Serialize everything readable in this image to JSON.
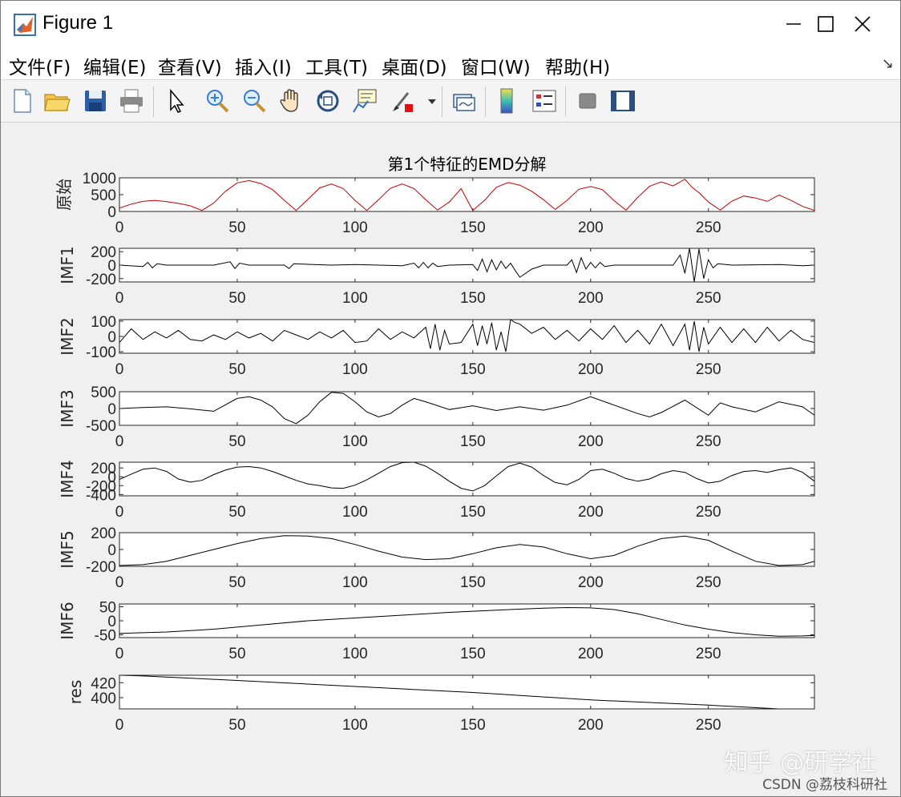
{
  "window": {
    "title": "Figure 1"
  },
  "menubar": {
    "items": [
      "文件(F)",
      "编辑(E)",
      "查看(V)",
      "插入(I)",
      "工具(T)",
      "桌面(D)",
      "窗口(W)",
      "帮助(H)"
    ]
  },
  "toolbar": {
    "icons": [
      "new-figure-icon",
      "open-file-icon",
      "save-icon",
      "print-icon",
      "select-arrow-icon",
      "zoom-in-icon",
      "zoom-out-icon",
      "pan-hand-icon",
      "rotate-3d-icon",
      "data-cursor-icon",
      "brush-icon",
      "link-plot-icon",
      "colorbar-icon",
      "legend-icon",
      "hide-plot-tools-icon",
      "show-plot-tools-icon"
    ]
  },
  "colors": {
    "original_line": "#c00000",
    "imf_line": "#000000",
    "axes_bg": "#ffffff",
    "figure_bg": "#f0f0f0"
  },
  "watermark": {
    "zhihu": "知乎 @研学社",
    "csdn": "CSDN @荔枝科研社"
  },
  "chart_data": {
    "type": "line",
    "title": "第1个特征的EMD分解",
    "xlim": [
      0,
      295
    ],
    "xticks": [
      0,
      50,
      100,
      150,
      200,
      250
    ],
    "subplots": [
      {
        "ylabel": "原始",
        "ylim": [
          0,
          1000
        ],
        "yticks": [
          0,
          500,
          1000
        ],
        "color": "#c00000",
        "x": [
          0,
          5,
          10,
          15,
          20,
          25,
          30,
          35,
          40,
          45,
          50,
          55,
          60,
          65,
          70,
          75,
          80,
          85,
          90,
          95,
          100,
          105,
          110,
          115,
          120,
          125,
          130,
          135,
          140,
          145,
          150,
          155,
          160,
          165,
          170,
          175,
          180,
          185,
          190,
          195,
          200,
          205,
          210,
          215,
          220,
          225,
          230,
          235,
          240,
          243,
          246,
          250,
          255,
          260,
          265,
          270,
          275,
          280,
          285,
          290,
          295
        ],
        "y": [
          100,
          220,
          300,
          330,
          290,
          240,
          170,
          30,
          250,
          600,
          850,
          920,
          830,
          650,
          330,
          30,
          360,
          700,
          820,
          680,
          330,
          30,
          350,
          690,
          820,
          680,
          350,
          40,
          280,
          680,
          30,
          330,
          720,
          860,
          780,
          600,
          350,
          60,
          330,
          660,
          740,
          650,
          320,
          40,
          420,
          750,
          880,
          760,
          960,
          720,
          560,
          280,
          40,
          310,
          460,
          400,
          300,
          490,
          330,
          150,
          30
        ]
      },
      {
        "ylabel": "IMF1",
        "ylim": [
          -250,
          250
        ],
        "yticks": [
          -200,
          0,
          200
        ],
        "color": "#000000",
        "x": [
          0,
          10,
          12,
          14,
          16,
          20,
          40,
          47,
          49,
          51,
          55,
          70,
          72,
          74,
          90,
          100,
          120,
          125,
          127,
          129,
          131,
          133,
          135,
          140,
          150,
          152,
          154,
          156,
          158,
          160,
          162,
          164,
          166,
          168,
          170,
          175,
          180,
          190,
          192,
          194,
          196,
          198,
          200,
          202,
          204,
          206,
          210,
          220,
          235,
          238,
          240,
          242,
          244,
          246,
          248,
          250,
          252,
          254,
          260,
          280,
          290,
          295
        ],
        "y": [
          0,
          -20,
          40,
          -40,
          20,
          0,
          0,
          50,
          -50,
          30,
          0,
          0,
          -50,
          20,
          0,
          10,
          -10,
          30,
          -40,
          40,
          -40,
          30,
          -20,
          0,
          10,
          -80,
          90,
          -100,
          80,
          -70,
          60,
          -50,
          30,
          -80,
          -180,
          -60,
          0,
          0,
          80,
          -110,
          110,
          -60,
          40,
          -40,
          40,
          -20,
          0,
          0,
          0,
          150,
          -120,
          250,
          -250,
          240,
          -200,
          80,
          -40,
          20,
          0,
          10,
          -10,
          0
        ]
      },
      {
        "ylabel": "IMF2",
        "ylim": [
          -110,
          110
        ],
        "yticks": [
          -100,
          0,
          100
        ],
        "color": "#000000",
        "x": [
          0,
          5,
          10,
          15,
          20,
          25,
          30,
          35,
          40,
          45,
          50,
          55,
          60,
          65,
          70,
          75,
          80,
          85,
          90,
          95,
          100,
          105,
          110,
          115,
          120,
          125,
          130,
          132,
          134,
          136,
          138,
          140,
          145,
          150,
          152,
          154,
          156,
          158,
          160,
          162,
          164,
          166,
          168,
          170,
          175,
          180,
          185,
          190,
          195,
          200,
          205,
          210,
          215,
          220,
          225,
          230,
          235,
          240,
          242,
          244,
          246,
          248,
          250,
          255,
          260,
          265,
          270,
          275,
          280,
          285,
          290,
          295
        ],
        "y": [
          -40,
          50,
          -20,
          30,
          -10,
          40,
          -20,
          -30,
          10,
          -20,
          30,
          -10,
          20,
          -30,
          40,
          10,
          -20,
          30,
          -10,
          40,
          -40,
          -30,
          50,
          -20,
          30,
          -10,
          60,
          -80,
          80,
          -90,
          40,
          -50,
          -40,
          80,
          -60,
          70,
          -50,
          90,
          -90,
          30,
          -100,
          110,
          90,
          80,
          20,
          60,
          -20,
          40,
          -30,
          50,
          -20,
          70,
          -40,
          40,
          -50,
          80,
          -60,
          80,
          -90,
          100,
          -100,
          60,
          -50,
          60,
          -40,
          50,
          -40,
          60,
          -30,
          40,
          -20,
          -40
        ]
      },
      {
        "ylabel": "IMF3",
        "ylim": [
          -500,
          500
        ],
        "yticks": [
          -500,
          0,
          500
        ],
        "color": "#000000",
        "x": [
          0,
          10,
          20,
          30,
          40,
          50,
          55,
          60,
          65,
          70,
          75,
          80,
          85,
          90,
          95,
          100,
          105,
          110,
          115,
          120,
          125,
          130,
          140,
          150,
          160,
          170,
          180,
          190,
          200,
          210,
          220,
          225,
          230,
          240,
          250,
          255,
          260,
          270,
          280,
          290,
          295
        ],
        "y": [
          0,
          30,
          50,
          -10,
          -80,
          300,
          350,
          250,
          50,
          -300,
          -450,
          -200,
          200,
          480,
          450,
          200,
          -100,
          -250,
          -150,
          100,
          300,
          200,
          -30,
          80,
          -60,
          50,
          -50,
          100,
          350,
          100,
          -150,
          -250,
          -120,
          250,
          -200,
          170,
          50,
          -100,
          200,
          50,
          -200
        ]
      },
      {
        "ylabel": "IMF4",
        "ylim": [
          -430,
          330
        ],
        "yticks": [
          -400,
          -200,
          0,
          200
        ],
        "color": "#000000",
        "x": [
          0,
          5,
          10,
          15,
          20,
          25,
          30,
          35,
          40,
          45,
          50,
          55,
          60,
          65,
          70,
          75,
          80,
          85,
          90,
          95,
          100,
          105,
          110,
          115,
          120,
          125,
          130,
          135,
          140,
          145,
          150,
          155,
          160,
          165,
          170,
          175,
          180,
          185,
          190,
          195,
          200,
          205,
          210,
          215,
          220,
          225,
          230,
          235,
          240,
          245,
          250,
          255,
          260,
          265,
          270,
          275,
          280,
          285,
          290,
          295
        ],
        "y": [
          -60,
          60,
          170,
          200,
          120,
          -50,
          -120,
          -80,
          50,
          150,
          220,
          230,
          200,
          120,
          20,
          -80,
          -160,
          -200,
          -250,
          -260,
          -190,
          -70,
          80,
          230,
          320,
          330,
          240,
          80,
          -100,
          -260,
          -320,
          -200,
          20,
          230,
          310,
          220,
          30,
          -130,
          -180,
          -60,
          140,
          170,
          80,
          -40,
          -100,
          -50,
          70,
          140,
          100,
          -40,
          -140,
          -100,
          30,
          120,
          140,
          100,
          160,
          200,
          100,
          -100
        ]
      },
      {
        "ylabel": "IMF5",
        "ylim": [
          -200,
          200
        ],
        "yticks": [
          -200,
          0,
          200
        ],
        "color": "#000000",
        "x": [
          0,
          10,
          20,
          30,
          40,
          50,
          60,
          70,
          80,
          90,
          100,
          110,
          120,
          130,
          140,
          150,
          160,
          170,
          180,
          190,
          200,
          210,
          220,
          230,
          240,
          250,
          260,
          270,
          280,
          290,
          295
        ],
        "y": [
          -190,
          -180,
          -140,
          -70,
          0,
          70,
          130,
          165,
          160,
          130,
          60,
          -20,
          -90,
          -120,
          -110,
          -50,
          20,
          60,
          30,
          -50,
          -110,
          -70,
          40,
          130,
          160,
          110,
          -20,
          -140,
          -190,
          -180,
          -140
        ]
      },
      {
        "ylabel": "IMF6",
        "ylim": [
          -60,
          60
        ],
        "yticks": [
          -50,
          0,
          50
        ],
        "color": "#000000",
        "x": [
          0,
          20,
          40,
          60,
          80,
          100,
          120,
          140,
          160,
          180,
          190,
          200,
          210,
          220,
          230,
          240,
          250,
          260,
          270,
          280,
          290,
          295
        ],
        "y": [
          -45,
          -40,
          -30,
          -15,
          0,
          10,
          20,
          30,
          38,
          45,
          47,
          46,
          40,
          25,
          5,
          -15,
          -30,
          -42,
          -50,
          -55,
          -54,
          -52
        ]
      },
      {
        "ylabel": "res",
        "ylim": [
          385,
          430
        ],
        "yticks": [
          400,
          420
        ],
        "color": "#000000",
        "x": [
          0,
          10,
          50,
          100,
          150,
          200,
          250,
          280,
          285
        ],
        "y": [
          430,
          429,
          423,
          415,
          407,
          397,
          390,
          385,
          385
        ]
      }
    ]
  }
}
